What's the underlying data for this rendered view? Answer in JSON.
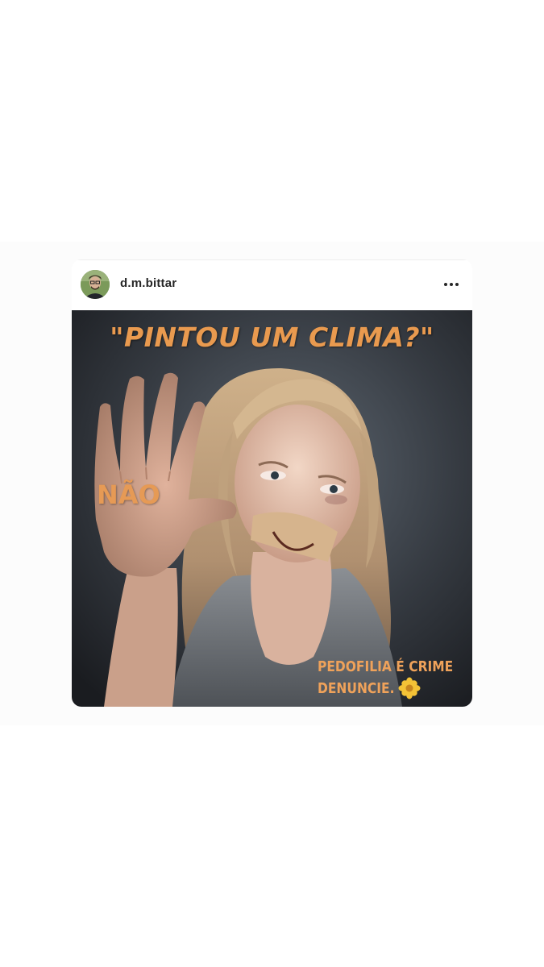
{
  "post": {
    "username": "d.m.bittar",
    "more_icon": "more-horizontal-icon",
    "image": {
      "headline": "\"PINTOU UM CLIMA?\"",
      "hand_text": "NÃO",
      "caption_line1": "PEDOFILIA É CRIME",
      "caption_line2": "DENUNCIE.",
      "caption_icon": "flower-icon"
    }
  },
  "colors": {
    "page_background": "#ffffff",
    "image_background": "#2e3238",
    "text_accent": "#e99a4f",
    "username": "#262626"
  }
}
